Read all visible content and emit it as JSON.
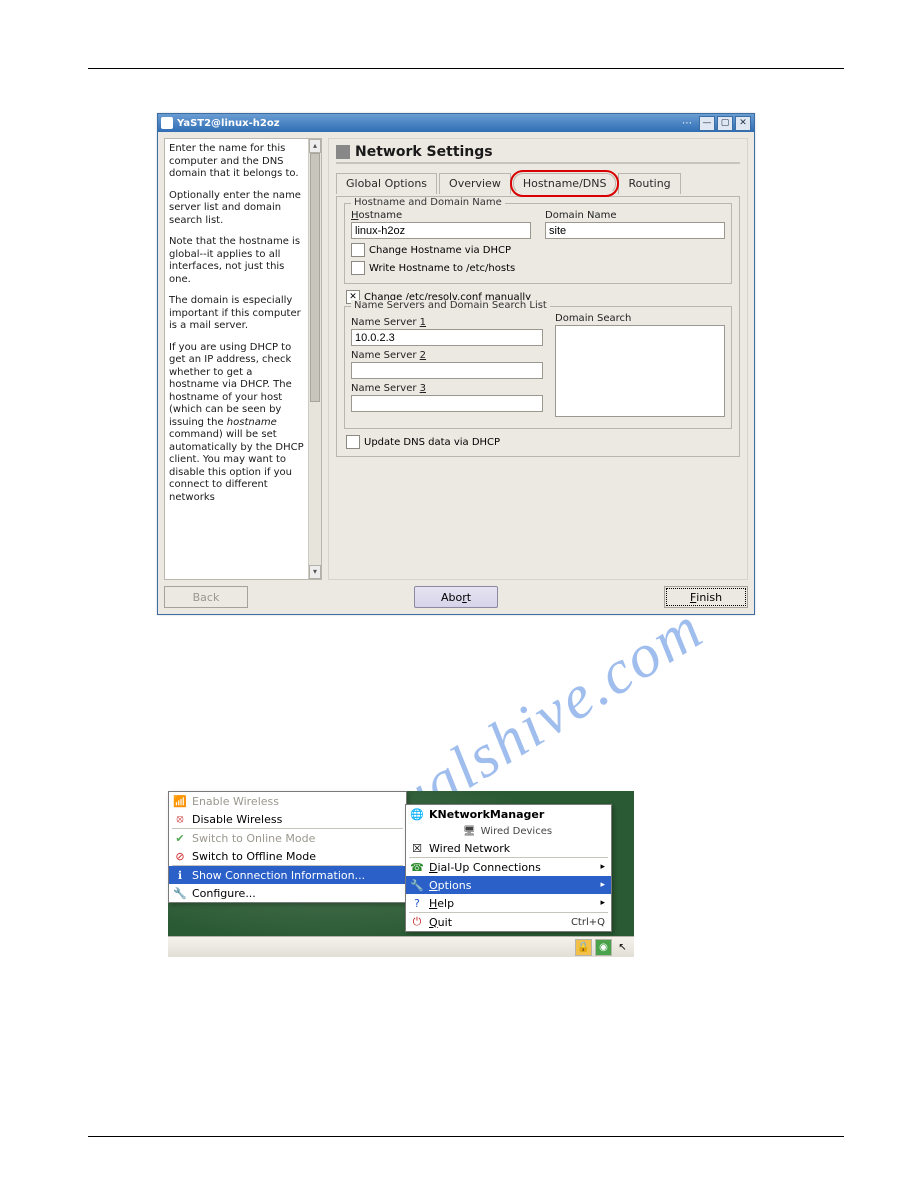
{
  "watermark": "manualshive.com",
  "yast": {
    "title": "YaST2@linux-h2oz",
    "help": {
      "p1": "Enter the name for this computer and the DNS domain that it belongs to.",
      "p2": "Optionally enter the name server list and domain search list.",
      "p3_a": "Note that the hostname is global--it applies to all interfaces, not just this one.",
      "p4": "The domain is especially important if this computer is a mail server.",
      "p5_a": "If you are using DHCP to get an IP address, check whether to get a hostname via DHCP. The hostname of your host (which can be seen by issuing the ",
      "p5_em": "hostname",
      "p5_b": " command) will be set automatically by the DHCP client. You may want to disable this option if you connect to different networks"
    },
    "page_title": "Network Settings",
    "tabs": {
      "global": "Global Options",
      "overview": "Overview",
      "hostname": "Hostname/DNS",
      "routing": "Routing"
    },
    "grp_hostname": "Hostname and Domain Name",
    "hostname_label_pre": "H",
    "hostname_label_post": "ostname",
    "hostname_value": "linux-h2oz",
    "domain_label": "Domain Name",
    "domain_value": "site",
    "ck_change": "Change Hostname via DHCP",
    "ck_write_pre": "W",
    "ck_write_post": "rite Hostname to /etc/hosts",
    "ck_resolv": "Change /etc/resolv.conf manually",
    "grp_ns": "Name Servers and Domain Search List",
    "ns1_pre": "Name Server ",
    "ns1_u": "1",
    "ns1_value": "10.0.2.3",
    "ns2_pre": "Name Server ",
    "ns2_u": "2",
    "ns3_pre": "Name Server ",
    "ns3_u": "3",
    "ds_label": "Domain Search",
    "ck_update_pre": "U",
    "ck_update_post": "pdate DNS data via DHCP",
    "btn_back": "Back",
    "btn_abort_a": "Abo",
    "btn_abort_u": "r",
    "btn_abort_b": "t",
    "btn_finish_u": "F",
    "btn_finish_b": "inish"
  },
  "knm": {
    "left": {
      "enable": "Enable Wireless",
      "disable": "Disable Wireless",
      "online": "Switch to Online Mode",
      "offline": "Switch to Offline Mode",
      "show": "Show Connection Information...",
      "configure": "Configure..."
    },
    "right": {
      "title": "KNetworkManager",
      "wired_hdr": "Wired Devices",
      "wired": "Wired Network",
      "dial_u": "D",
      "dial_b": "ial-Up Connections",
      "options_u": "O",
      "options_b": "ptions",
      "help_u": "H",
      "help_b": "elp",
      "quit_u": "Q",
      "quit_b": "uit",
      "quit_sc": "Ctrl+Q"
    }
  }
}
